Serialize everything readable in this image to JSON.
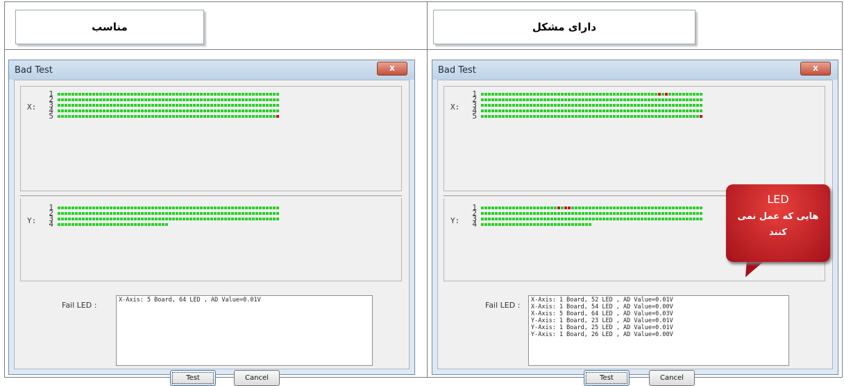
{
  "headers": {
    "left": "مناسب",
    "right": "دارای مشکل"
  },
  "colors": {
    "led_ok": "#2ad02a",
    "led_fail": "#c4141b",
    "callout": "#c4141b"
  },
  "windows": [
    {
      "title": "Bad Test",
      "close_label": "x",
      "x_axis_label": "X:",
      "y_axis_label": "Y:",
      "x_rows": [
        {
          "num": "1",
          "leds": 64,
          "failed": []
        },
        {
          "num": "2",
          "leds": 64,
          "failed": []
        },
        {
          "num": "3",
          "leds": 64,
          "failed": []
        },
        {
          "num": "4",
          "leds": 64,
          "failed": []
        },
        {
          "num": "5",
          "leds": 64,
          "failed": [
            64
          ]
        }
      ],
      "y_rows": [
        {
          "num": "1",
          "leds": 64,
          "failed": []
        },
        {
          "num": "2",
          "leds": 64,
          "failed": []
        },
        {
          "num": "3",
          "leds": 64,
          "failed": []
        },
        {
          "num": "4",
          "leds": 32,
          "failed": []
        }
      ],
      "fail_label": "Fail LED :",
      "fail_lines": [
        "X-Axis: 5 Board, 64 LED , AD Value=0.01V"
      ],
      "test_label": "Test",
      "cancel_label": "Cancel"
    },
    {
      "title": "Bad Test",
      "close_label": "x",
      "x_axis_label": "X:",
      "y_axis_label": "Y:",
      "x_rows": [
        {
          "num": "1",
          "leds": 64,
          "failed": [
            52,
            54
          ]
        },
        {
          "num": "2",
          "leds": 64,
          "failed": []
        },
        {
          "num": "3",
          "leds": 64,
          "failed": []
        },
        {
          "num": "4",
          "leds": 64,
          "failed": []
        },
        {
          "num": "5",
          "leds": 64,
          "failed": [
            64
          ]
        }
      ],
      "y_rows": [
        {
          "num": "1",
          "leds": 64,
          "failed": [
            23,
            25,
            26
          ]
        },
        {
          "num": "2",
          "leds": 64,
          "failed": []
        },
        {
          "num": "3",
          "leds": 64,
          "failed": []
        },
        {
          "num": "4",
          "leds": 32,
          "failed": []
        }
      ],
      "fail_label": "Fail LED :",
      "fail_lines": [
        "X-Axis: 1 Board, 52 LED , AD Value=0.01V",
        "X-Axis: 1 Board, 54 LED , AD Value=0.00V",
        "X-Axis: 5 Board, 64 LED , AD Value=0.03V",
        "Y-Axis: 1 Board, 23 LED , AD Value=0.01V",
        "Y-Axis: 1 Board, 25 LED , AD Value=0.01V",
        "Y-Axis: 1 Board, 26 LED , AD Value=0.00V"
      ],
      "test_label": "Test",
      "cancel_label": "Cancel"
    }
  ],
  "callout": {
    "line1": "LED",
    "line2": "هایی که عمل نمی",
    "line3": "کنند"
  }
}
